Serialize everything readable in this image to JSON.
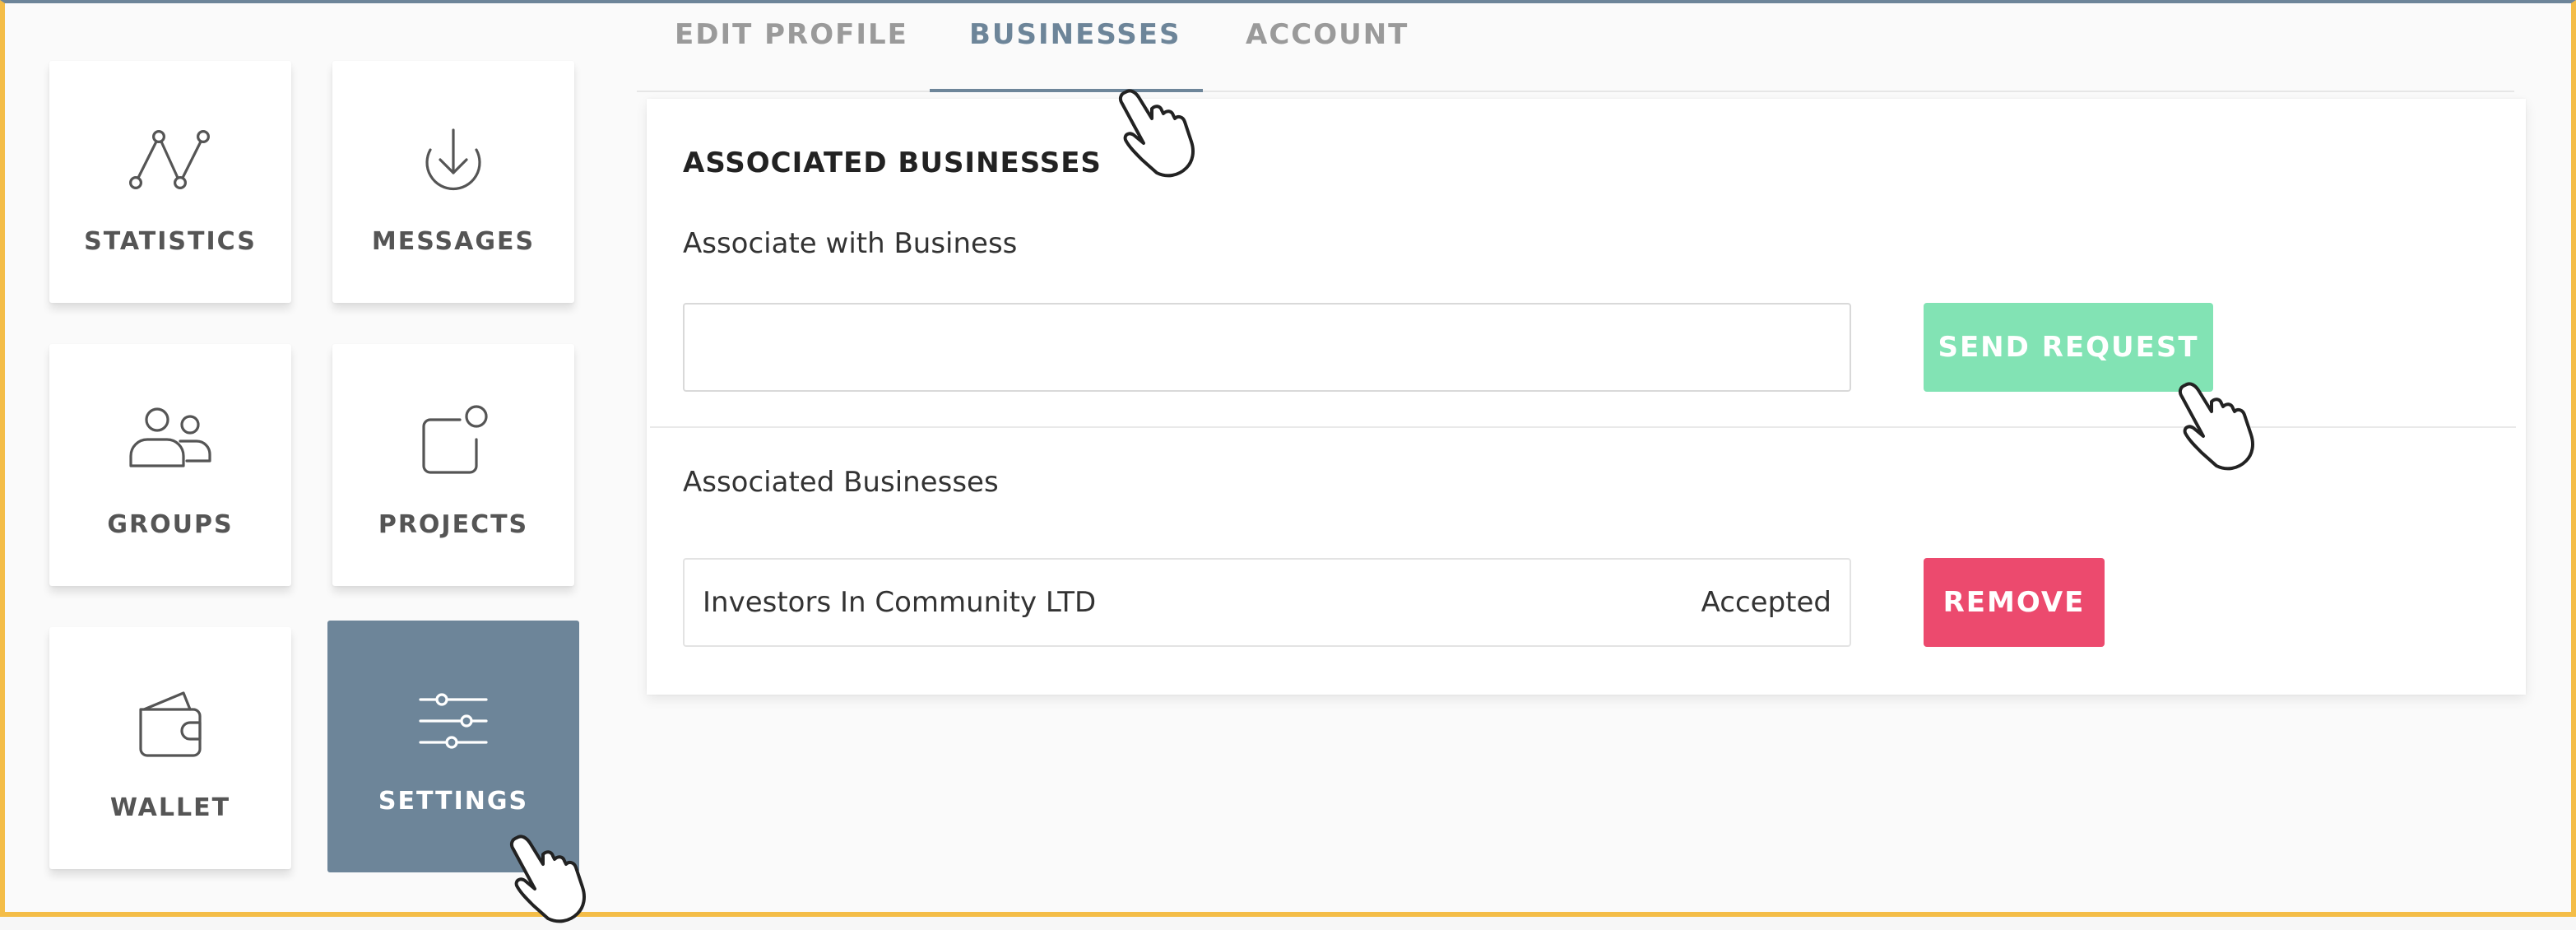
{
  "sidebar": {
    "items": [
      {
        "label": "STATISTICS",
        "icon": "statistics-icon"
      },
      {
        "label": "MESSAGES",
        "icon": "download-icon"
      },
      {
        "label": "GROUPS",
        "icon": "groups-icon"
      },
      {
        "label": "PROJECTS",
        "icon": "projects-icon"
      },
      {
        "label": "WALLET",
        "icon": "wallet-icon"
      },
      {
        "label": "SETTINGS",
        "icon": "sliders-icon"
      }
    ],
    "active": "SETTINGS"
  },
  "tabs": [
    {
      "label": "EDIT PROFILE"
    },
    {
      "label": "BUSINESSES"
    },
    {
      "label": "ACCOUNT"
    }
  ],
  "active_tab": "BUSINESSES",
  "card": {
    "title": "ASSOCIATED BUSINESSES",
    "associate_label": "Associate with Business",
    "input_value": "",
    "input_placeholder": "",
    "send_button": "SEND REQUEST",
    "list_label": "Associated Businesses",
    "businesses": [
      {
        "name": "Investors In Community LTD",
        "status": "Accepted",
        "action": "REMOVE"
      }
    ]
  },
  "colors": {
    "accent": "#6d8599",
    "send": "#82e3b4",
    "remove": "#ec4a6e",
    "frame": "#f4bd48"
  }
}
